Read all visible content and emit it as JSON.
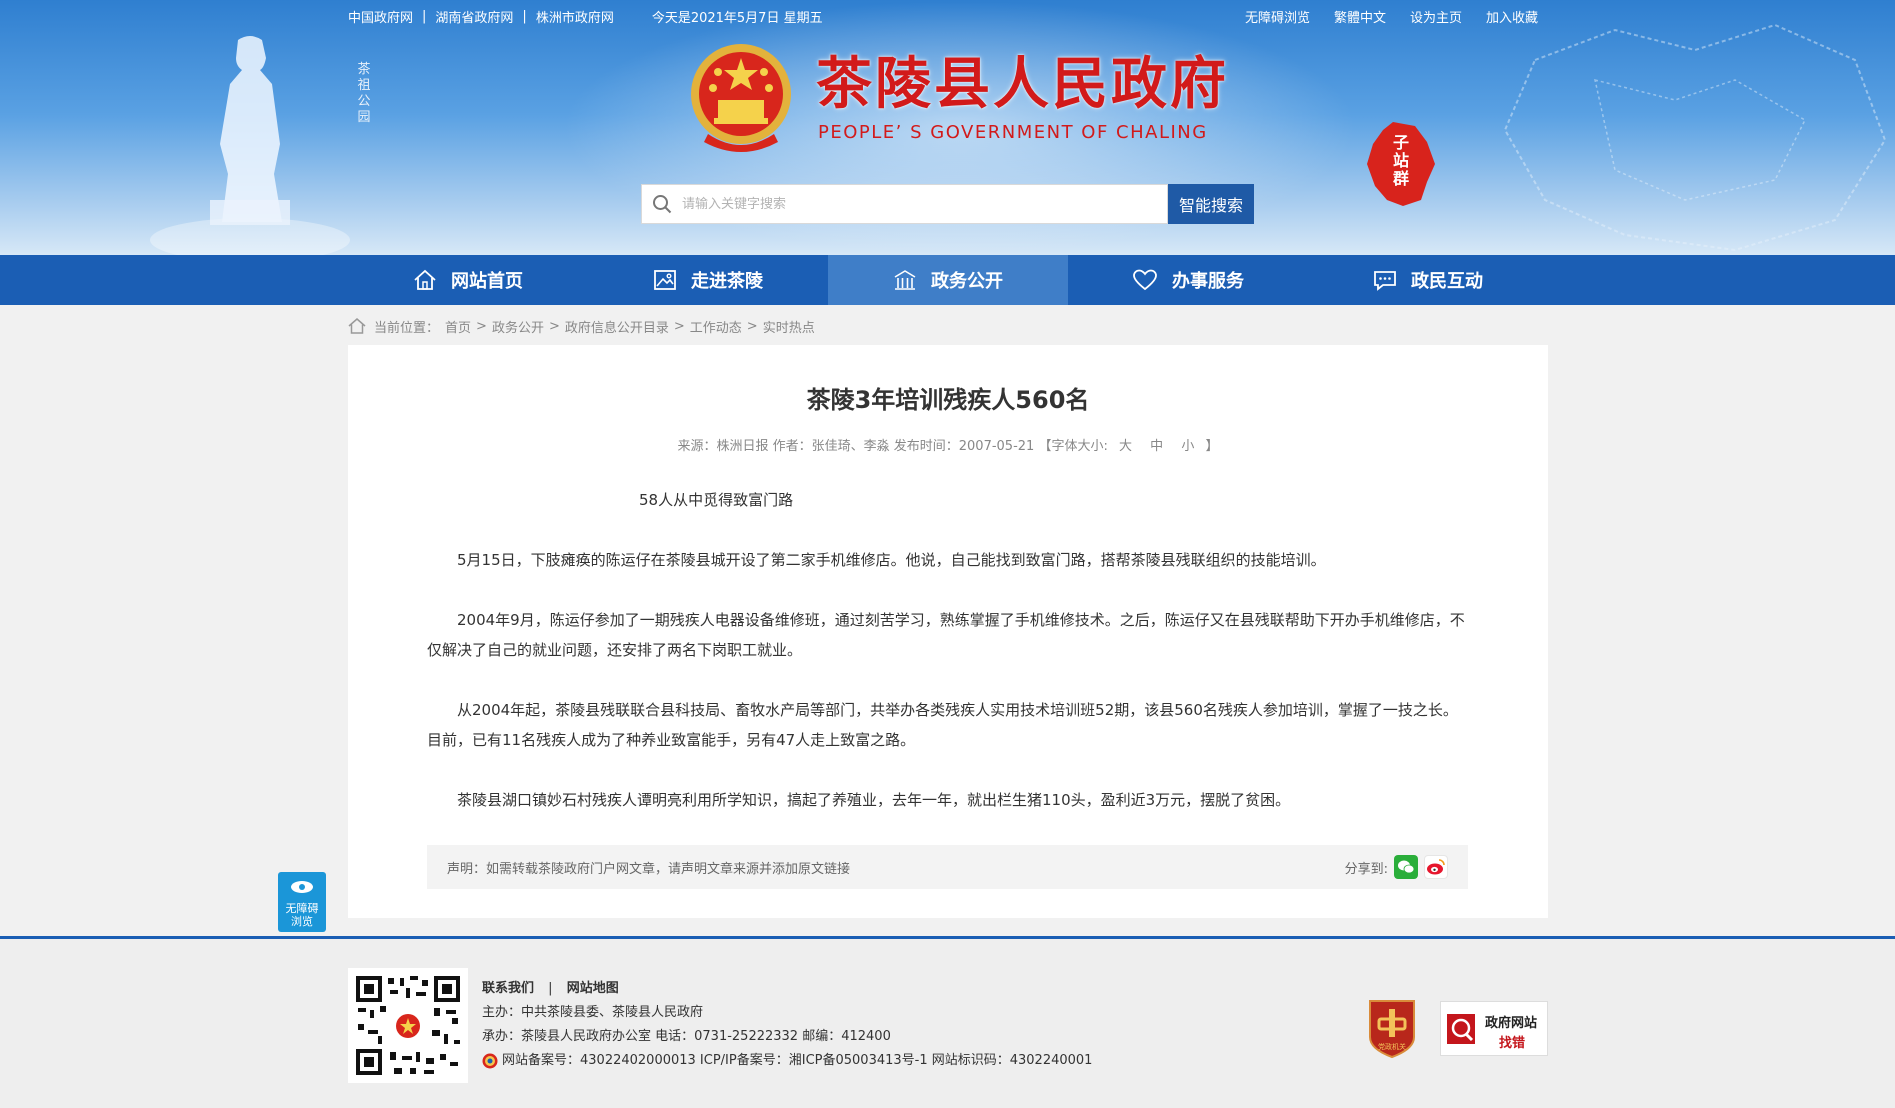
{
  "top_links": [
    "中国政府网",
    "湖南省政府网",
    "株洲市政府网"
  ],
  "date_text": "今天是2021年5月7日 星期五",
  "right_links": [
    "无障碍浏览",
    "繁體中文",
    "设为主页",
    "加入收藏"
  ],
  "banner": {
    "vertical_text": "茶祖公园",
    "title": "茶陵县人民政府",
    "subtitle": "PEOPLE’ S GOVERNMENT OF CHALING",
    "subsite_label": "子站群"
  },
  "search": {
    "placeholder": "请输入关键字搜索",
    "button": "智能搜索"
  },
  "nav": [
    {
      "label": "网站首页",
      "icon": "home-icon",
      "active": false
    },
    {
      "label": "走进茶陵",
      "icon": "picture-icon",
      "active": false
    },
    {
      "label": "政务公开",
      "icon": "building-icon",
      "active": true
    },
    {
      "label": "办事服务",
      "icon": "heart-icon",
      "active": false
    },
    {
      "label": "政民互动",
      "icon": "chat-icon",
      "active": false
    }
  ],
  "breadcrumb": {
    "prefix": "当前位置：",
    "items": [
      "首页",
      "政务公开",
      "政府信息公开目录",
      "工作动态",
      "实时热点"
    ]
  },
  "article": {
    "title": "茶陵3年培训残疾人560名",
    "meta": "来源：株洲日报 作者：张佳琦、李淼 发布时间：2007-05-21",
    "font_size_label": "【字体大小:",
    "font_sizes": [
      "大",
      "中",
      "小"
    ],
    "font_size_end": "】",
    "subtitle": "58人从中觅得致富门路",
    "paragraphs": [
      "5月15日，下肢瘫痪的陈运仔在茶陵县城开设了第二家手机维修店。他说，自己能找到致富门路，搭帮茶陵县残联组织的技能培训。",
      "2004年9月，陈运仔参加了一期残疾人电器设备维修班，通过刻苦学习，熟练掌握了手机维修技术。之后，陈运仔又在县残联帮助下开办手机维修店，不仅解决了自己的就业问题，还安排了两名下岗职工就业。",
      "从2004年起，茶陵县残联联合县科技局、畜牧水产局等部门，共举办各类残疾人实用技术培训班52期，该县560名残疾人参加培训，掌握了一技之长。目前，已有11名残疾人成为了种养业致富能手，另有47人走上致富之路。",
      "茶陵县湖口镇妙石村残疾人谭明亮利用所学知识，搞起了养殖业，去年一年，就出栏生猪110头，盈利近3万元，摆脱了贫困。"
    ],
    "declare": "声明：如需转载茶陵政府门户网文章，请声明文章来源并添加原文链接",
    "share_label": "分享到:"
  },
  "accessible_button": "无障碍浏览",
  "footer": {
    "links": [
      "联系我们",
      "网站地图"
    ],
    "host": "主办：中共茶陵县委、茶陵县人民政府",
    "organizer": "承办：茶陵县人民政府办公室 电话：0731-25222332 邮编：412400",
    "record": "网站备案号：43022402000013 ICP/IP备案号：湘ICP备05003413号-1 网站标识码：4302240001",
    "party_badge": "党政机关",
    "error_badge_line1": "政府网站",
    "error_badge_line2": "找错"
  },
  "colors": {
    "nav_bg": "#1b5eb4",
    "nav_active": "#3f7ec8",
    "title_red": "#d21a1a",
    "search_button": "#1f5aa6"
  }
}
